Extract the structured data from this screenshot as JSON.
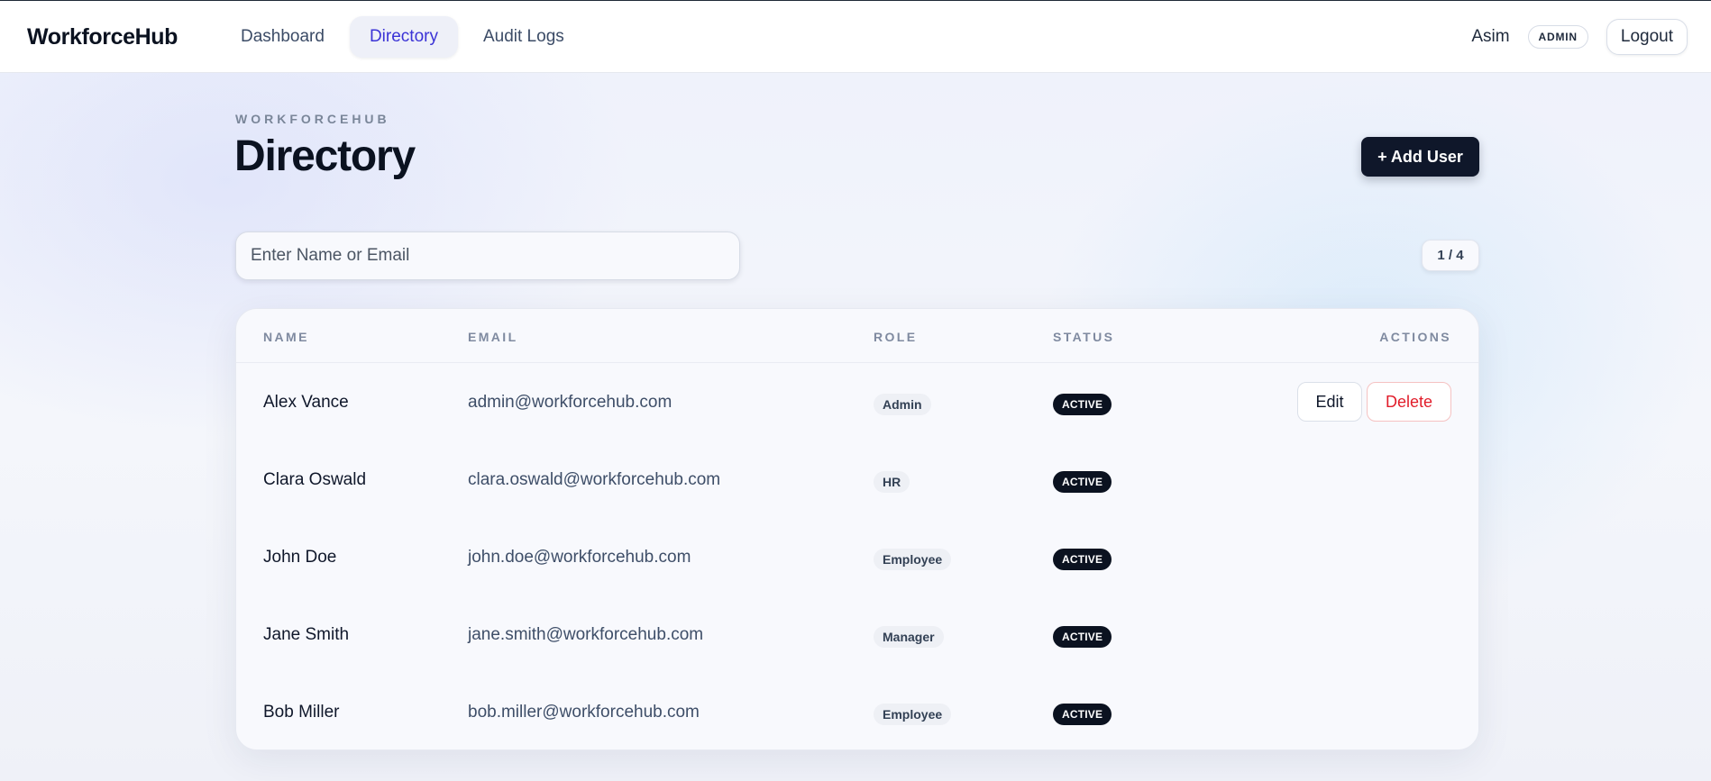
{
  "app": {
    "brand": "WorkforceHub"
  },
  "nav": [
    {
      "label": "Dashboard",
      "active": false
    },
    {
      "label": "Directory",
      "active": true
    },
    {
      "label": "Audit Logs",
      "active": false
    }
  ],
  "user": {
    "name": "Asim",
    "role_badge": "ADMIN",
    "logout_label": "Logout"
  },
  "page": {
    "eyebrow": "WORKFORCEHUB",
    "title": "Directory",
    "add_button_label": "+ Add User"
  },
  "search": {
    "placeholder": "Enter Name or Email",
    "value": ""
  },
  "pagination": {
    "label": "1 / 4"
  },
  "table": {
    "columns": [
      "NAME",
      "EMAIL",
      "ROLE",
      "STATUS",
      "ACTIONS"
    ],
    "rows": [
      {
        "name": "Alex Vance",
        "email": "admin@workforcehub.com",
        "role": "Admin",
        "status": "ACTIVE",
        "actions": {
          "edit": "Edit",
          "delete": "Delete"
        }
      },
      {
        "name": "Clara Oswald",
        "email": "clara.oswald@workforcehub.com",
        "role": "HR",
        "status": "ACTIVE"
      },
      {
        "name": "John Doe",
        "email": "john.doe@workforcehub.com",
        "role": "Employee",
        "status": "ACTIVE"
      },
      {
        "name": "Jane Smith",
        "email": "jane.smith@workforcehub.com",
        "role": "Manager",
        "status": "ACTIVE"
      },
      {
        "name": "Bob Miller",
        "email": "bob.miller@workforcehub.com",
        "role": "Employee",
        "status": "ACTIVE"
      }
    ]
  },
  "colors": {
    "accent": "#3b33d6",
    "primary_dark": "#0f172a",
    "danger": "#e11d2a"
  }
}
